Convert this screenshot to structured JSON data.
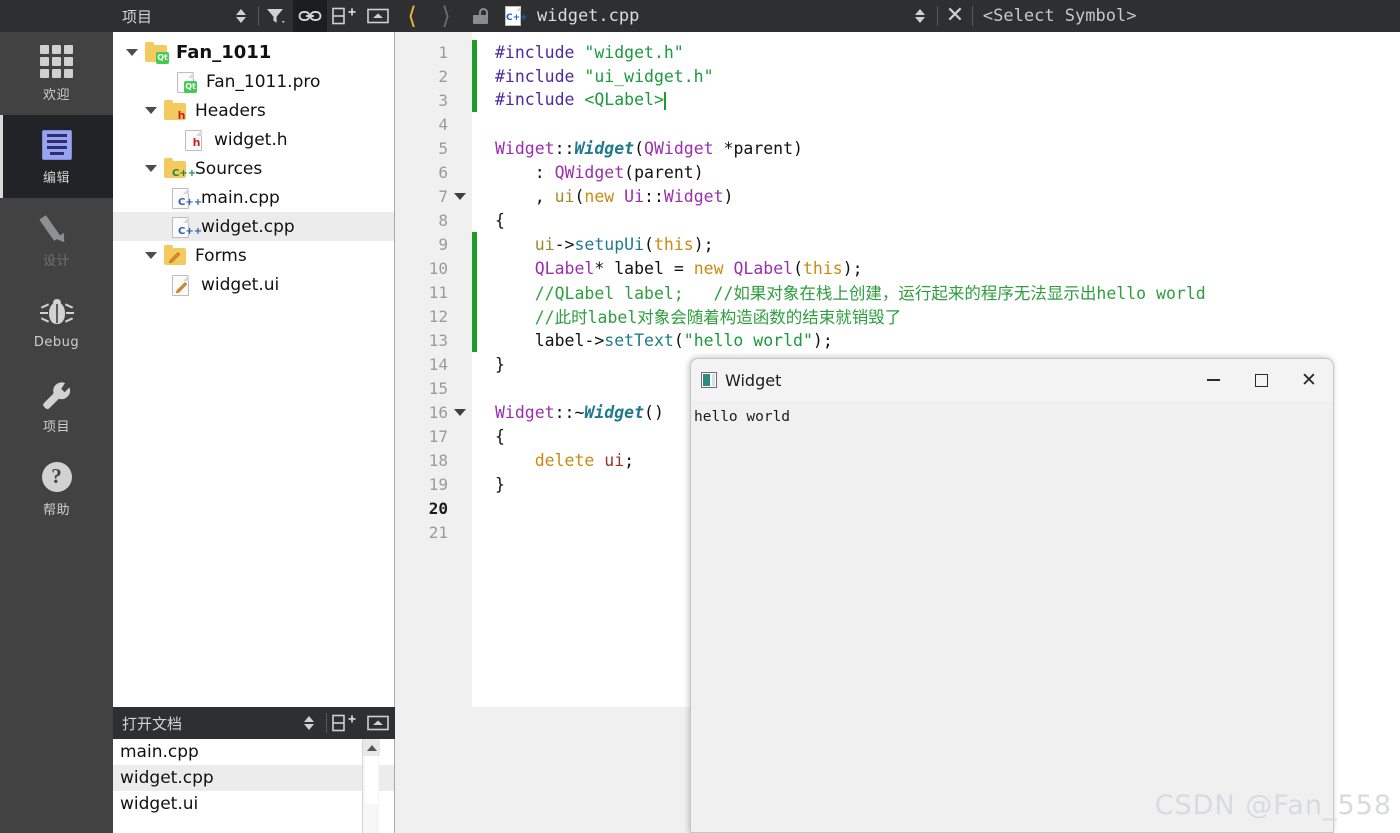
{
  "modebar": {
    "items": [
      {
        "label": "欢迎",
        "icon": "grid-icon",
        "state": "normal"
      },
      {
        "label": "编辑",
        "icon": "edit-lines-icon",
        "state": "active"
      },
      {
        "label": "设计",
        "icon": "pencil-icon",
        "state": "disabled"
      },
      {
        "label": "Debug",
        "icon": "bug-icon",
        "state": "normal"
      },
      {
        "label": "项目",
        "icon": "wrench-icon",
        "state": "normal"
      },
      {
        "label": "帮助",
        "icon": "question-mark-icon",
        "state": "normal"
      }
    ]
  },
  "project_panel": {
    "title": "项目",
    "toolbar": [
      {
        "name": "sort-chevrons-icon",
        "active": false
      },
      {
        "name": "filter-icon",
        "active": false
      },
      {
        "name": "link-sync-icon",
        "active": true
      },
      {
        "name": "split-add-icon",
        "active": false
      },
      {
        "name": "minimize-panel-icon",
        "active": false
      }
    ],
    "tree": [
      {
        "label": "Fan_1011",
        "indent": 0,
        "icon": "folder-qt",
        "arrow": "down",
        "bold": true,
        "selected": false
      },
      {
        "label": "Fan_1011.pro",
        "indent": 1,
        "icon": "file-qt",
        "arrow": "none",
        "bold": false,
        "selected": false
      },
      {
        "label": "Headers",
        "indent": 1,
        "icon": "folder-h",
        "arrow": "down",
        "bold": false,
        "selected": false
      },
      {
        "label": "widget.h",
        "indent": 2,
        "icon": "file-h",
        "arrow": "none",
        "bold": false,
        "selected": false
      },
      {
        "label": "Sources",
        "indent": 1,
        "icon": "folder-cpp",
        "arrow": "down",
        "bold": false,
        "selected": false
      },
      {
        "label": "main.cpp",
        "indent": 2,
        "icon": "file-cpp",
        "arrow": "none",
        "bold": false,
        "selected": false
      },
      {
        "label": "widget.cpp",
        "indent": 2,
        "icon": "file-cpp",
        "arrow": "none",
        "bold": false,
        "selected": true
      },
      {
        "label": "Forms",
        "indent": 1,
        "icon": "folder-ui",
        "arrow": "down",
        "bold": false,
        "selected": false
      },
      {
        "label": "widget.ui",
        "indent": 2,
        "icon": "file-ui",
        "arrow": "none",
        "bold": false,
        "selected": false
      }
    ]
  },
  "open_documents": {
    "title": "打开文档",
    "toolbar": [
      {
        "name": "sort-chevrons-icon"
      },
      {
        "name": "split-add-icon"
      },
      {
        "name": "minimize-panel-icon"
      }
    ],
    "items": [
      {
        "label": "main.cpp",
        "selected": false
      },
      {
        "label": "widget.cpp",
        "selected": true
      },
      {
        "label": "widget.ui",
        "selected": false
      }
    ]
  },
  "editor_toolbar": {
    "back_icon": "chevron-left-icon",
    "forward_icon": "chevron-right-icon",
    "lock_icon": "unlocked-padlock-icon",
    "file_icon": "cpp-file-icon",
    "filename": "widget.cpp",
    "dropdown_icon": "sort-chevrons-icon",
    "close_icon": "close-x-icon",
    "symbol_selector": "<Select Symbol>"
  },
  "editor": {
    "current_line": 20,
    "lines": [
      {
        "n": 1,
        "fold": false,
        "change": true,
        "tokens": [
          {
            "t": "#include ",
            "c": "k-pre"
          },
          {
            "t": "\"widget.h\"",
            "c": "k-str"
          }
        ]
      },
      {
        "n": 2,
        "fold": false,
        "change": true,
        "tokens": [
          {
            "t": "#include ",
            "c": "k-pre"
          },
          {
            "t": "\"ui_widget.h\"",
            "c": "k-str"
          }
        ]
      },
      {
        "n": 3,
        "fold": false,
        "change": true,
        "caret": true,
        "tokens": [
          {
            "t": "#include ",
            "c": "k-pre"
          },
          {
            "t": "<QLabel>",
            "c": "k-str"
          }
        ]
      },
      {
        "n": 4,
        "fold": false,
        "change": false,
        "tokens": []
      },
      {
        "n": 5,
        "fold": false,
        "change": false,
        "tokens": [
          {
            "t": "Widget",
            "c": "k-type"
          },
          {
            "t": "::",
            "c": "k-plain"
          },
          {
            "t": "Widget",
            "c": "k-fn"
          },
          {
            "t": "(",
            "c": "k-plain"
          },
          {
            "t": "QWidget",
            "c": "k-type"
          },
          {
            "t": " *parent)",
            "c": "k-plain"
          }
        ]
      },
      {
        "n": 6,
        "fold": false,
        "change": false,
        "tokens": [
          {
            "t": "    : ",
            "c": "k-plain"
          },
          {
            "t": "QWidget",
            "c": "k-type"
          },
          {
            "t": "(parent)",
            "c": "k-plain"
          }
        ]
      },
      {
        "n": 7,
        "fold": true,
        "change": false,
        "tokens": [
          {
            "t": "    , ",
            "c": "k-plain"
          },
          {
            "t": "ui",
            "c": "k-var"
          },
          {
            "t": "(",
            "c": "k-plain"
          },
          {
            "t": "new",
            "c": "k-kw"
          },
          {
            "t": " ",
            "c": "k-plain"
          },
          {
            "t": "Ui",
            "c": "k-type"
          },
          {
            "t": "::",
            "c": "k-plain"
          },
          {
            "t": "Widget",
            "c": "k-type"
          },
          {
            "t": ")",
            "c": "k-plain"
          }
        ]
      },
      {
        "n": 8,
        "fold": false,
        "change": false,
        "tokens": [
          {
            "t": "{",
            "c": "k-plain"
          }
        ]
      },
      {
        "n": 9,
        "fold": false,
        "change": true,
        "tokens": [
          {
            "t": "    ",
            "c": "k-plain"
          },
          {
            "t": "ui",
            "c": "k-var"
          },
          {
            "t": "->",
            "c": "k-plain"
          },
          {
            "t": "setupUi",
            "c": "k-fn2"
          },
          {
            "t": "(",
            "c": "k-plain"
          },
          {
            "t": "this",
            "c": "k-kw"
          },
          {
            "t": ");",
            "c": "k-plain"
          }
        ]
      },
      {
        "n": 10,
        "fold": false,
        "change": true,
        "tokens": [
          {
            "t": "    ",
            "c": "k-plain"
          },
          {
            "t": "QLabel",
            "c": "k-type"
          },
          {
            "t": "* label = ",
            "c": "k-plain"
          },
          {
            "t": "new",
            "c": "k-kw"
          },
          {
            "t": " ",
            "c": "k-plain"
          },
          {
            "t": "QLabel",
            "c": "k-type"
          },
          {
            "t": "(",
            "c": "k-plain"
          },
          {
            "t": "this",
            "c": "k-kw"
          },
          {
            "t": ");",
            "c": "k-plain"
          }
        ]
      },
      {
        "n": 11,
        "fold": false,
        "change": true,
        "tokens": [
          {
            "t": "    //QLabel label;   //如果对象在栈上创建，运行起来的程序无法显示出hello world",
            "c": "k-cmt"
          }
        ]
      },
      {
        "n": 12,
        "fold": false,
        "change": true,
        "tokens": [
          {
            "t": "    //此时label对象会随着构造函数的结束就销毁了",
            "c": "k-cmt"
          }
        ]
      },
      {
        "n": 13,
        "fold": false,
        "change": true,
        "tokens": [
          {
            "t": "    label",
            "c": "k-plain"
          },
          {
            "t": "->",
            "c": "k-plain"
          },
          {
            "t": "setText",
            "c": "k-fn2"
          },
          {
            "t": "(",
            "c": "k-plain"
          },
          {
            "t": "\"hello world\"",
            "c": "k-str"
          },
          {
            "t": ");",
            "c": "k-plain"
          }
        ]
      },
      {
        "n": 14,
        "fold": false,
        "change": false,
        "tokens": [
          {
            "t": "}",
            "c": "k-plain"
          }
        ]
      },
      {
        "n": 15,
        "fold": false,
        "change": false,
        "tokens": []
      },
      {
        "n": 16,
        "fold": true,
        "change": false,
        "tokens": [
          {
            "t": "Widget",
            "c": "k-type"
          },
          {
            "t": "::~",
            "c": "k-plain"
          },
          {
            "t": "Widget",
            "c": "k-fn"
          },
          {
            "t": "()",
            "c": "k-plain"
          }
        ]
      },
      {
        "n": 17,
        "fold": false,
        "change": false,
        "tokens": [
          {
            "t": "{",
            "c": "k-plain"
          }
        ]
      },
      {
        "n": 18,
        "fold": false,
        "change": false,
        "tokens": [
          {
            "t": "    ",
            "c": "k-plain"
          },
          {
            "t": "delete",
            "c": "k-kw"
          },
          {
            "t": " ",
            "c": "k-plain"
          },
          {
            "t": "ui",
            "c": "k-red"
          },
          {
            "t": ";",
            "c": "k-plain"
          }
        ]
      },
      {
        "n": 19,
        "fold": false,
        "change": false,
        "tokens": [
          {
            "t": "}",
            "c": "k-plain"
          }
        ]
      },
      {
        "n": 20,
        "fold": false,
        "change": false,
        "tokens": []
      },
      {
        "n": 21,
        "fold": false,
        "change": false,
        "tokens": []
      }
    ]
  },
  "widget_window": {
    "title": "Widget",
    "app_icon": "app-square-icon",
    "minimize_label": "—",
    "maximize_label": "□",
    "close_label": "✕",
    "content_text": "hello world"
  },
  "watermark": "CSDN @Fan_558",
  "colors": {
    "modebar_bg": "#424242",
    "active_tab_bg": "#222326",
    "panel_header_bg": "#2e2f30",
    "editor_bg": "#ffffff",
    "gutter_bg": "#f0f0f0",
    "change_bar": "#1e9e28",
    "accent_back_arrow": "#e8b738",
    "selection_bg": "#ececec",
    "string_green": "#1a9a3c",
    "comment_green": "#2e9e3e",
    "type_purple": "#9b2fae",
    "keyword_orange": "#c98a12"
  }
}
